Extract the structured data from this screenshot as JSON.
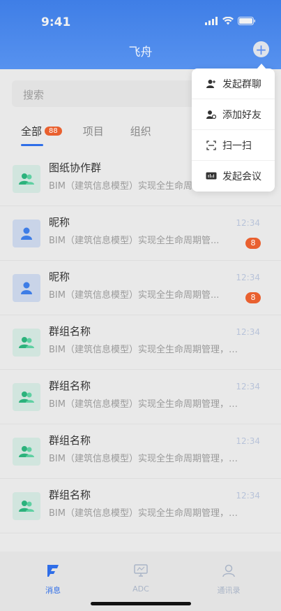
{
  "status": {
    "time": "9:41"
  },
  "header": {
    "title": "飞舟"
  },
  "search": {
    "placeholder": "搜索"
  },
  "tabs": [
    {
      "label": "全部",
      "badge": "88"
    },
    {
      "label": "项目"
    },
    {
      "label": "组织"
    }
  ],
  "conversations": [
    {
      "title": "图纸协作群",
      "subtitle": "BIM（建筑信息模型）实现全生命周期管理，参与方协同",
      "time": "",
      "badge": "",
      "avatar": "group"
    },
    {
      "title": "昵称",
      "subtitle": "BIM（建筑信息模型）实现全生命周期管...",
      "time": "12:34",
      "badge": "8",
      "avatar": "person"
    },
    {
      "title": "昵称",
      "subtitle": "BIM（建筑信息模型）实现全生命周期管...",
      "time": "12:34",
      "badge": "8",
      "avatar": "person"
    },
    {
      "title": "群组名称",
      "subtitle": "BIM（建筑信息模型）实现全生命周期管理，参...",
      "time": "12:34",
      "badge": "",
      "avatar": "group"
    },
    {
      "title": "群组名称",
      "subtitle": "BIM（建筑信息模型）实现全生命周期管理，参...",
      "time": "12:34",
      "badge": "",
      "avatar": "group"
    },
    {
      "title": "群组名称",
      "subtitle": "BIM（建筑信息模型）实现全生命周期管理，参...",
      "time": "12:34",
      "badge": "",
      "avatar": "group"
    },
    {
      "title": "群组名称",
      "subtitle": "BIM（建筑信息模型）实现全生命周期管理，参...",
      "time": "12:34",
      "badge": "",
      "avatar": "group"
    }
  ],
  "popup_menu": [
    {
      "label": "发起群聊",
      "icon": "user-plus-icon"
    },
    {
      "label": "添加好友",
      "icon": "add-friend-icon"
    },
    {
      "label": "扫一扫",
      "icon": "scan-icon"
    },
    {
      "label": "发起会议",
      "icon": "meeting-icon"
    }
  ],
  "tabbar": [
    {
      "label": "消息",
      "icon": "message-icon",
      "active": true
    },
    {
      "label": "ADC",
      "icon": "monitor-icon",
      "active": false
    },
    {
      "label": "通讯录",
      "icon": "contacts-icon",
      "active": false
    }
  ],
  "colors": {
    "accent": "#2f6ee8",
    "badge": "#e9602f",
    "header_top": "#3f7ee6",
    "header_bottom": "#5792ef"
  }
}
